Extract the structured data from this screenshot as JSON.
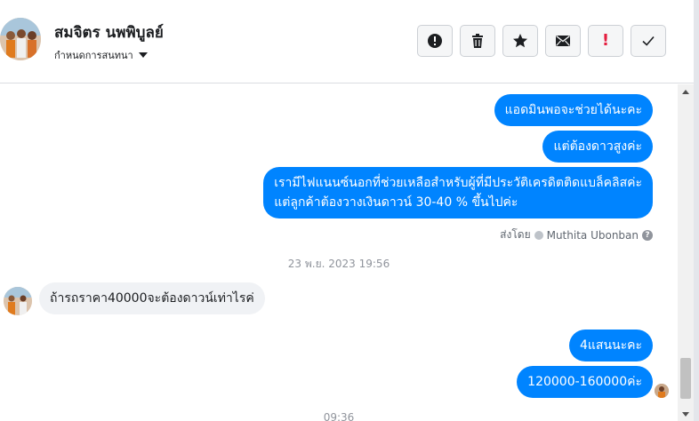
{
  "header": {
    "contact_name": "สมจิตร นพพิบูลย์",
    "assign_label": "กำหนดการสนทนา",
    "action_icons": [
      "alert-circle-icon",
      "trash-icon",
      "star-icon",
      "envelope-icon",
      "exclamation-icon",
      "check-icon"
    ]
  },
  "thread": {
    "outgoing_top": [
      {
        "text": "แอดมินพอจะช่วยได้นะคะ"
      },
      {
        "text": "แต่ต้องดาวสูงค่ะ"
      },
      {
        "lines": [
          "เรามีไฟแนนซ์นอกที่ช่วยเหลือสำหรับผู้ที่มีประวัติเครดิตติดแบล็คลิสค่ะ",
          "แต่ลูกค้าต้องวางเงินดาวน์ 30-40 % ขึ้นไปค่ะ"
        ]
      }
    ],
    "sent_by_label": "ส่งโดย",
    "sent_by_name": "Muthita Ubonban",
    "date_divider": "23 พ.ย. 2023 19:56",
    "incoming": {
      "text": "ถ้ารถราคา40000จะต้องดาวน์เท่าไรค่"
    },
    "outgoing_bottom": [
      {
        "text": "4แสนนะคะ"
      },
      {
        "text": "120000-160000ค่ะ"
      }
    ],
    "next_time_partial": "09:36"
  },
  "colors": {
    "outgoing_bubble": "#0084ff",
    "incoming_bubble": "#f0f2f5",
    "report_red": "#e41e3f"
  }
}
